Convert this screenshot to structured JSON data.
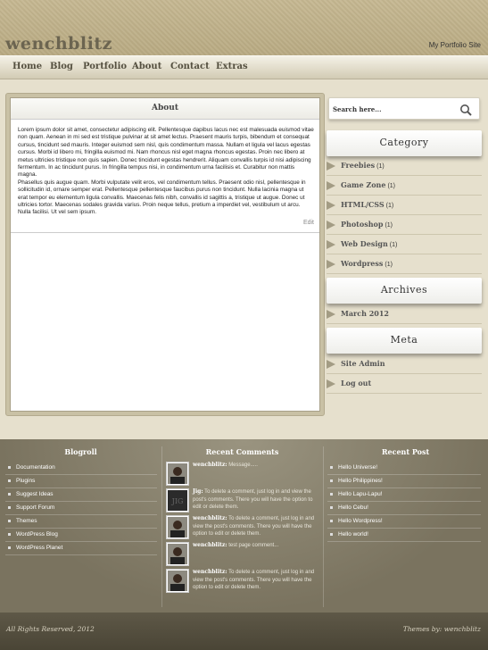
{
  "header": {
    "site_title": "wenchblitz",
    "tagline": "My Portfolio Site"
  },
  "nav": {
    "items": [
      {
        "label": "Home"
      },
      {
        "label": "Blog"
      },
      {
        "label": "Portfolio"
      },
      {
        "label": "About"
      },
      {
        "label": "Contact"
      },
      {
        "label": "Extras"
      }
    ]
  },
  "main": {
    "heading": "About",
    "paragraph_1": "Lorem ipsum dolor sit amet, consectetur adipiscing elit. Pellentesque dapibus lacus nec est malesuada euismod vitae non quam. Aenean in mi sed est tristique pulvinar at sit amet lectus. Praesent mauris turpis, bibendum et consequat cursus, tincidunt sed mauris. Integer euismod sem nisl, quis condimentum massa. Nullam et ligula vel lacus egestas cursus. Morbi id libero mi, fringilla euismod mi. Nam rhoncus nisl eget magna rhoncus egestas. Proin nec libero at metus ultricies tristique non quis sapien. Donec tincidunt egestas hendrerit. Aliquam convallis turpis id nisi adipiscing fermentum. In ac tincidunt purus. In fringilla tempus nisi, in condimentum urna facilisis et. Curabitur non mattis magna.",
    "paragraph_2": "Phasellus quis augue quam. Morbi vulputate velit eros, vel condimentum tellus. Praesent odio nisl, pellentesque in sollicitudin id, ornare semper erat. Pellentesque pellentesque faucibus purus non tincidunt. Nulla lacinia magna ut erat tempor eu elementum ligula convallis. Maecenas felis nibh, convallis id sagittis a, tristique ut augue. Donec ut ultricies tortor. Maecenas sodales gravida varius. Proin neque tellus, pretium a imperdiet vel, vestibulum ut arcu. Nulla facilisi. Ut vel sem ipsum.",
    "edit_label": "Edit"
  },
  "sidebar": {
    "search_placeholder": "Search here...",
    "category_title": "Category",
    "categories": [
      {
        "label": "Freebies",
        "count": "(1)"
      },
      {
        "label": "Game Zone",
        "count": "(1)"
      },
      {
        "label": "HTML/CSS",
        "count": "(1)"
      },
      {
        "label": "Photoshop",
        "count": "(1)"
      },
      {
        "label": "Web Design",
        "count": "(1)"
      },
      {
        "label": "Wordpress",
        "count": "(1)"
      }
    ],
    "archives_title": "Archives",
    "archives": [
      {
        "label": "March 2012"
      }
    ],
    "meta_title": "Meta",
    "meta": [
      {
        "label": "Site Admin"
      },
      {
        "label": "Log out"
      }
    ]
  },
  "footer": {
    "blogroll_title": "Blogroll",
    "blogroll": [
      {
        "label": "Documentation"
      },
      {
        "label": "Plugins"
      },
      {
        "label": "Suggest Ideas"
      },
      {
        "label": "Support Forum"
      },
      {
        "label": "Themes"
      },
      {
        "label": "WordPress Blog"
      },
      {
        "label": "WordPress Planet"
      }
    ],
    "comments_title": "Recent Comments",
    "comments": [
      {
        "author": "wenchblitz:",
        "text": "Message....."
      },
      {
        "author": "Jig:",
        "text": "To delete a comment, just log in and view the post's comments. There you will have the option to edit or delete them."
      },
      {
        "author": "wenchblitz:",
        "text": "To delete a comment, just log in and view the post's comments. There you will have the option to edit or delete them."
      },
      {
        "author": "wenchblitz:",
        "text": "test page comment..."
      },
      {
        "author": "wenchblitz:",
        "text": "To delete a comment, just log in and view the post's comments. There you will have the option to edit or delete them."
      }
    ],
    "posts_title": "Recent Post",
    "posts": [
      {
        "label": "Hello Universe!"
      },
      {
        "label": "Hello Philippines!"
      },
      {
        "label": "Hello Lapu-Lapu!"
      },
      {
        "label": "Hello Cebu!"
      },
      {
        "label": "Hello Wordpress!"
      },
      {
        "label": "Hello world!"
      }
    ],
    "copyright": "All Rights Reserved, 2012",
    "credits": "Themes by: wenchblitz"
  }
}
